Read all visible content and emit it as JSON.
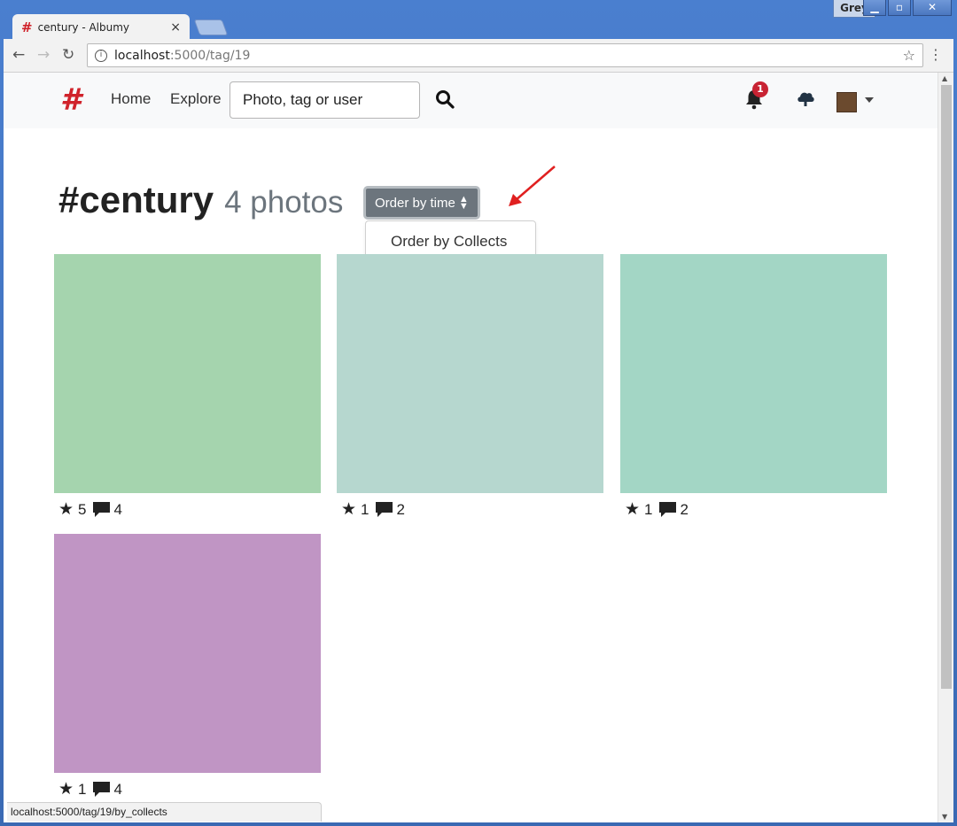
{
  "window": {
    "profile_name": "Grey",
    "minimize_icon": "minimize-icon",
    "maximize_icon": "maximize-icon",
    "close_icon": "close-icon"
  },
  "browser": {
    "tab_title": "century - Albumy",
    "tab_close": "×",
    "url_host": "localhost",
    "url_path": ":5000/tag/19",
    "status_url": "localhost:5000/tag/19/by_collects"
  },
  "navbar": {
    "brand": "#",
    "links": [
      "Home",
      "Explore"
    ],
    "search_placeholder": "Photo, tag or user",
    "notification_count": "1"
  },
  "page": {
    "tag_name": "#century",
    "photo_count": "4 photos",
    "order_button": "Order by time",
    "dropdown_items": [
      "Order by Collects"
    ]
  },
  "photos": [
    {
      "color": "#a5d4ae",
      "collects": "5",
      "comments": "4"
    },
    {
      "color": "#b6d7cf",
      "collects": "1",
      "comments": "2"
    },
    {
      "color": "#a3d6c5",
      "collects": "1",
      "comments": "2"
    },
    {
      "color": "#c095c4",
      "collects": "1",
      "comments": "4"
    }
  ],
  "colors": {
    "brand_red": "#d0232b",
    "secondary_button": "#6c757d",
    "annotation_arrow": "#e02020"
  }
}
